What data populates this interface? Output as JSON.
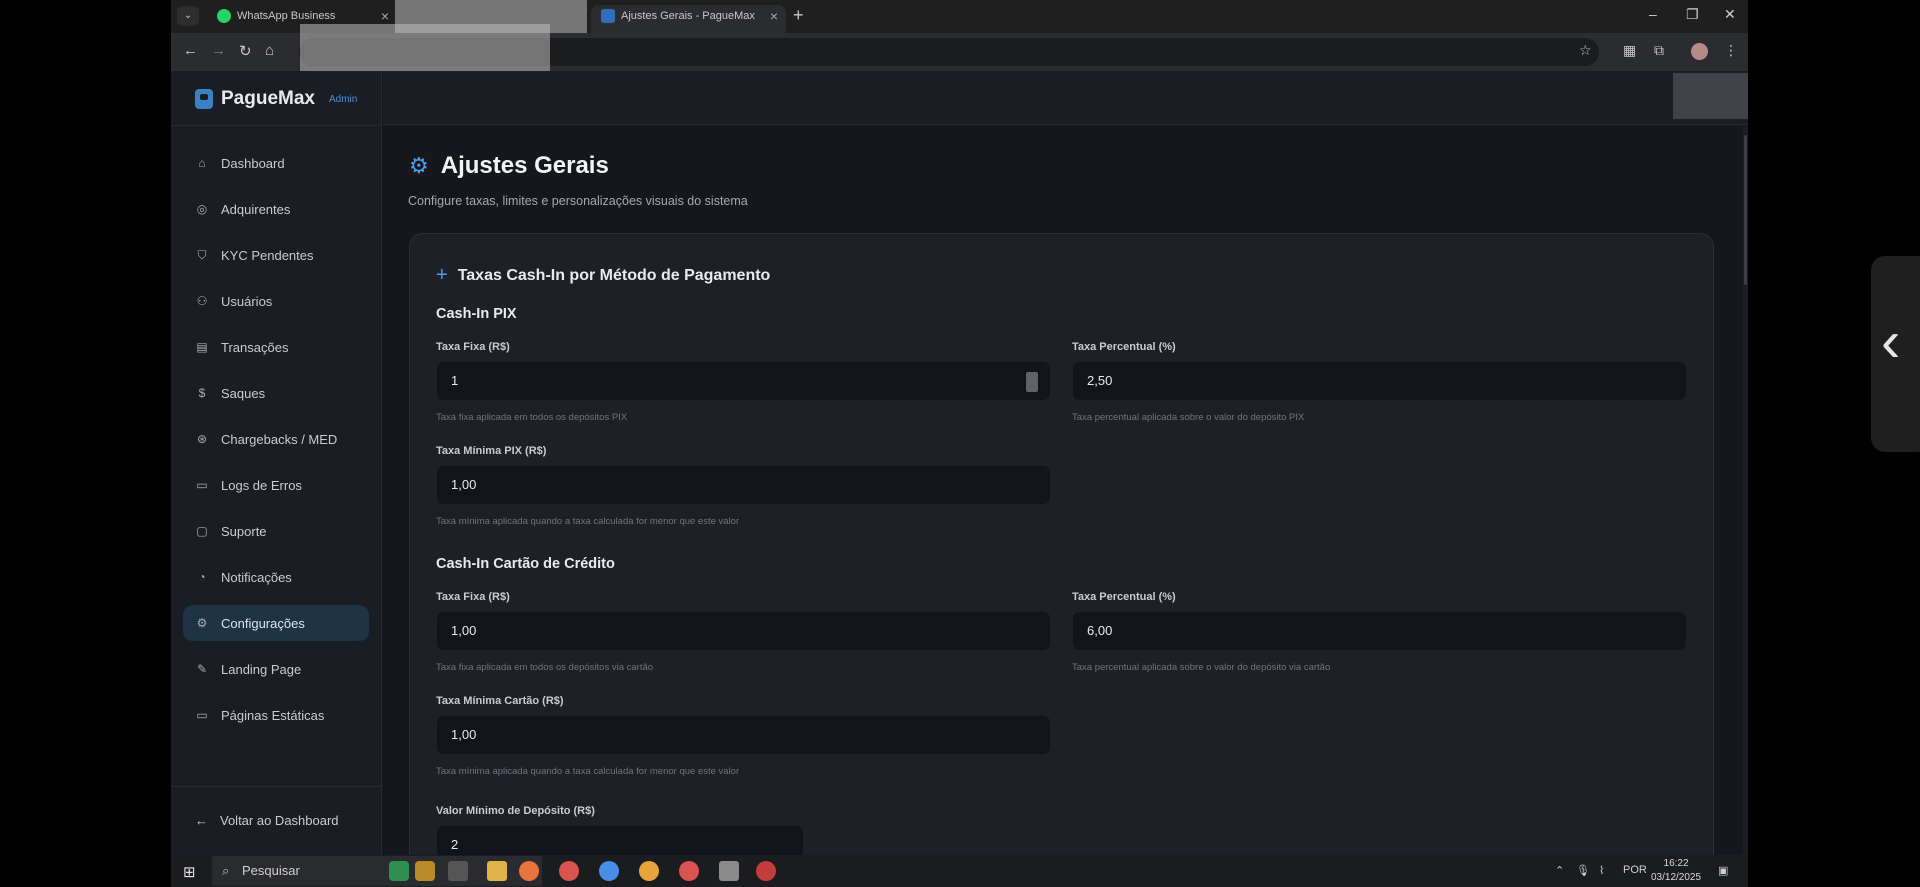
{
  "browser": {
    "tabs": [
      {
        "label": "WhatsApp Business"
      },
      {
        "label": "Ajustes Gerais - PagueMax"
      }
    ]
  },
  "sidebar": {
    "brand": "PagueMax",
    "badge": "Admin",
    "items": [
      {
        "label": "Dashboard",
        "icon": "home-icon"
      },
      {
        "label": "Adquirentes",
        "icon": "target-icon"
      },
      {
        "label": "KYC Pendentes",
        "icon": "shield-icon"
      },
      {
        "label": "Usuários",
        "icon": "users-icon"
      },
      {
        "label": "Transações",
        "icon": "clipboard-icon"
      },
      {
        "label": "Saques",
        "icon": "dollar-icon"
      },
      {
        "label": "Chargebacks / MED",
        "icon": "dollar-circle-icon"
      },
      {
        "label": "Logs de Erros",
        "icon": "file-icon"
      },
      {
        "label": "Suporte",
        "icon": "chat-icon"
      },
      {
        "label": "Notificações",
        "icon": "bell-icon"
      },
      {
        "label": "Configurações",
        "icon": "gear-icon",
        "active": true
      },
      {
        "label": "Landing Page",
        "icon": "edit-icon"
      },
      {
        "label": "Páginas Estáticas",
        "icon": "file-icon"
      }
    ],
    "back": "Voltar ao Dashboard"
  },
  "page": {
    "title": "Ajustes Gerais",
    "subtitle": "Configure taxas, limites e personalizações visuais do sistema"
  },
  "card": {
    "title": "Taxas Cash-In por Método de Pagamento",
    "pix": {
      "title": "Cash-In PIX",
      "fixed_label": "Taxa Fixa (R$)",
      "fixed_value": "1",
      "fixed_hint": "Taxa fixa aplicada em todos os depósitos PIX",
      "percent_label": "Taxa Percentual (%)",
      "percent_value": "2,50",
      "percent_hint": "Taxa percentual aplicada sobre o valor do depósito PIX",
      "min_label": "Taxa Mínima PIX (R$)",
      "min_value": "1,00",
      "min_hint": "Taxa mínima aplicada quando a taxa calculada for menor que este valor"
    },
    "card_credit": {
      "title": "Cash-In Cartão de Crédito",
      "fixed_label": "Taxa Fixa (R$)",
      "fixed_value": "1,00",
      "fixed_hint": "Taxa fixa aplicada em todos os depósitos via cartão",
      "percent_label": "Taxa Percentual (%)",
      "percent_value": "6,00",
      "percent_hint": "Taxa percentual aplicada sobre o valor do depósito via cartão",
      "min_label": "Taxa Mínima Cartão (R$)",
      "min_value": "1,00",
      "min_hint": "Taxa mínima aplicada quando a taxa calculada for menor que este valor"
    },
    "min_deposit_label": "Valor Mínimo de Depósito (R$)",
    "min_deposit_value": "2"
  },
  "taskbar": {
    "search": "Pesquisar",
    "lang": "POR",
    "time": "16:22",
    "date": "03/12/2025"
  },
  "colors": {
    "accent": "#4d9ee8",
    "background": "#15171c",
    "card": "#1d2027",
    "active_nav": "#1f3347"
  }
}
